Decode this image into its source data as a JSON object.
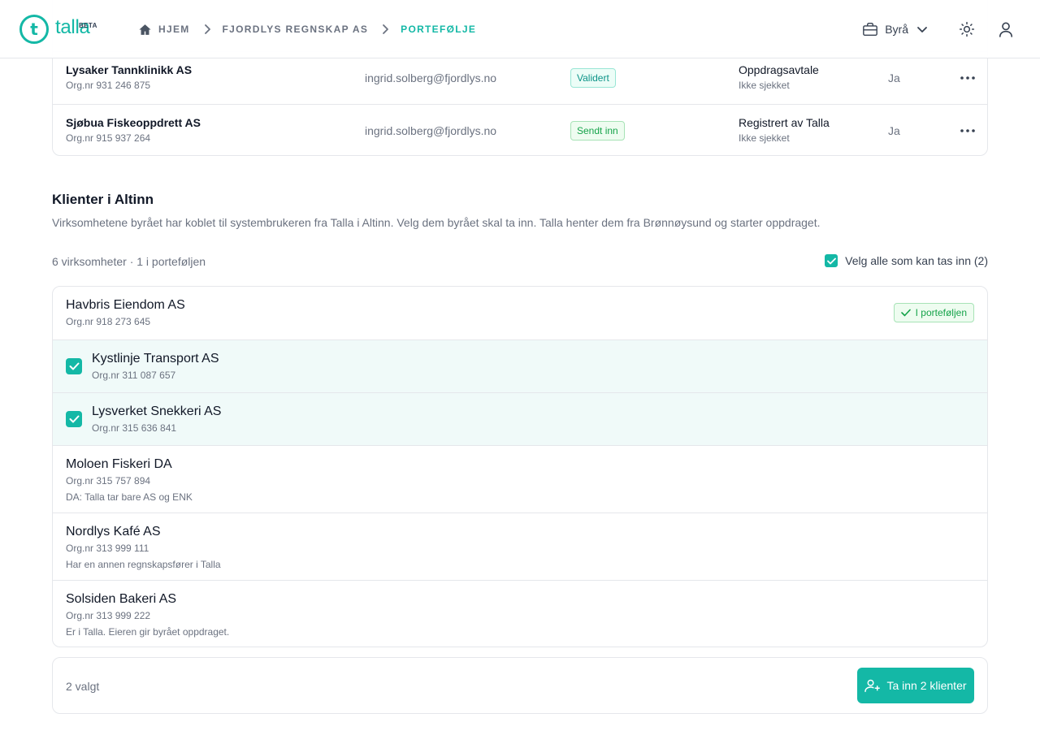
{
  "header": {
    "logo_text": "talla",
    "logo_badge": "BETA",
    "breadcrumb": [
      {
        "label": "HJEM"
      },
      {
        "label": "FJORDLYS REGNSKAP AS"
      },
      {
        "label": "PORTEFØLJE"
      }
    ],
    "org_switch_label": "Byrå",
    "icons": {
      "home": "home-icon",
      "org": "briefcase-icon",
      "theme": "sun-icon",
      "user": "user-icon"
    }
  },
  "portfolio_rows": [
    {
      "name": "Lysaker Tannklinikk AS",
      "org": "Org.nr 931 246 875",
      "email": "ingrid.solberg@fjordlys.no",
      "status": "Validert",
      "source": "Oppdragsavtale",
      "check": "Ikke sjekket",
      "active": "Ja"
    },
    {
      "name": "Sjøbua Fiskeoppdrett AS",
      "org": "Org.nr 915 937 264",
      "email": "ingrid.solberg@fjordlys.no",
      "status": "Sendt inn",
      "source": "Registrert av Talla",
      "check": "Ikke sjekket",
      "active": "Ja"
    }
  ],
  "altinn": {
    "title": "Klienter i Altinn",
    "description": "Virksomhetene byrået har koblet til systembrukeren fra Talla i Altinn. Velg dem byrået skal ta inn. Talla henter dem fra Brønnøysund og starter oppdraget.",
    "count_text": "6 virksomheter · 1 i porteføljen",
    "select_all_label": "Velg alle som kan tas inn (2)",
    "select_all_checked": true,
    "clients": [
      {
        "name": "Havbris Eiendom AS",
        "org": "Org.nr 918 273 645",
        "badge": "I porteføljen",
        "note": ""
      },
      {
        "name": "Kystlinje Transport AS",
        "org": "Org.nr 311 087 657",
        "checked": true,
        "note": ""
      },
      {
        "name": "Lysverket Snekkeri AS",
        "org": "Org.nr 315 636 841",
        "checked": true,
        "note": ""
      },
      {
        "name": "Moloen Fiskeri DA",
        "org": "Org.nr 315 757 894",
        "note": "DA: Talla tar bare AS og ENK"
      },
      {
        "name": "Nordlys Kafé AS",
        "org": "Org.nr 313 999 111",
        "note": "Har en annen regnskapsfører i Talla"
      },
      {
        "name": "Solsiden Bakeri AS",
        "org": "Org.nr 313 999 222",
        "note": "Er i Talla. Eieren gir byrået oppdraget."
      }
    ]
  },
  "footer": {
    "selected_count": "2 valgt",
    "action_label": "Ta inn 2 klienter"
  },
  "colors": {
    "accent": "#14b8a6",
    "success": "#16a34a",
    "muted": "#6b7280",
    "border": "#e5e7eb"
  }
}
